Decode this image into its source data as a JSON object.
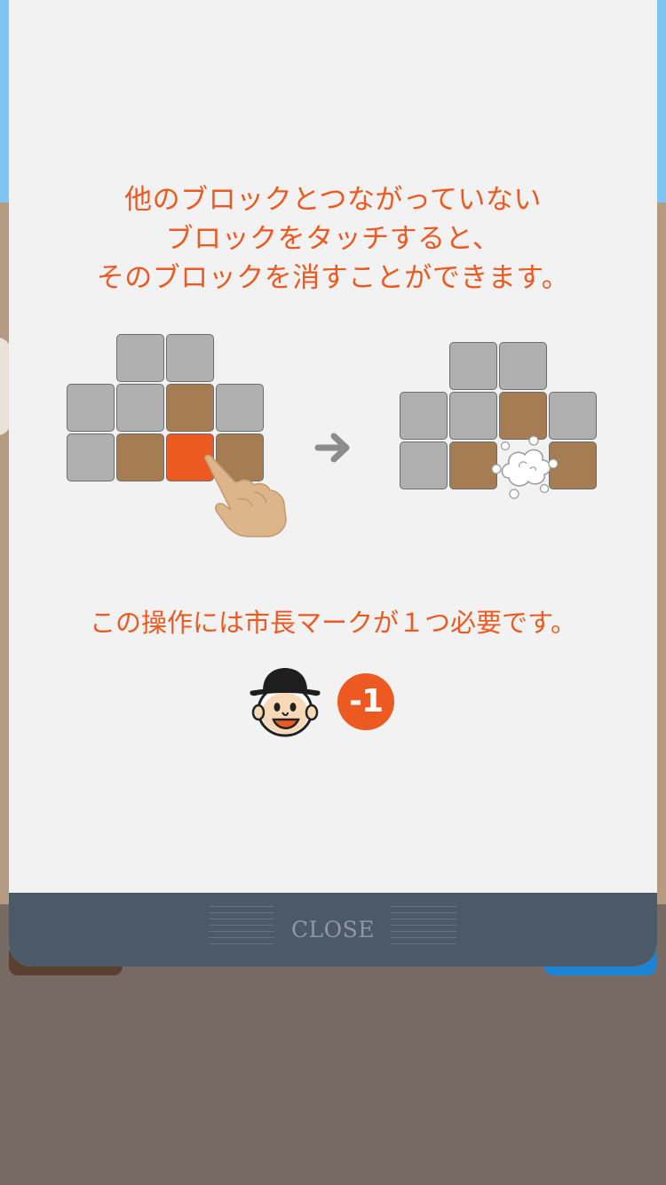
{
  "tutorial": {
    "title_lines": [
      "他のブロックとつながっていない",
      "ブロックをタッチすると、",
      "そのブロックを消すことができます。"
    ],
    "cost_text": "この操作には市長マークが１つ必要です。",
    "cost_badge": "-1",
    "icons": {
      "hand": "pointing-hand-icon",
      "arrow": "arrow-right-icon",
      "poof": "poof-cloud-icon",
      "mayor": "mayor-face-icon"
    }
  },
  "blocks_before": [
    [
      "empty",
      "gray",
      "gray",
      "empty"
    ],
    [
      "gray",
      "gray",
      "brown",
      "gray"
    ],
    [
      "gray",
      "brown",
      "orange",
      "brown"
    ]
  ],
  "blocks_after": [
    [
      "empty",
      "gray",
      "gray",
      "empty"
    ],
    [
      "gray",
      "gray",
      "brown",
      "gray"
    ],
    [
      "gray",
      "brown",
      "empty",
      "brown"
    ]
  ],
  "colors": {
    "accent": "#ec5a22",
    "block_gray": "#b0b0b0",
    "block_brown": "#a67d52",
    "panel_bg": "#f2f2f2",
    "close_bar": "#4c5967"
  },
  "footer": {
    "close_label": "CLOSE"
  }
}
